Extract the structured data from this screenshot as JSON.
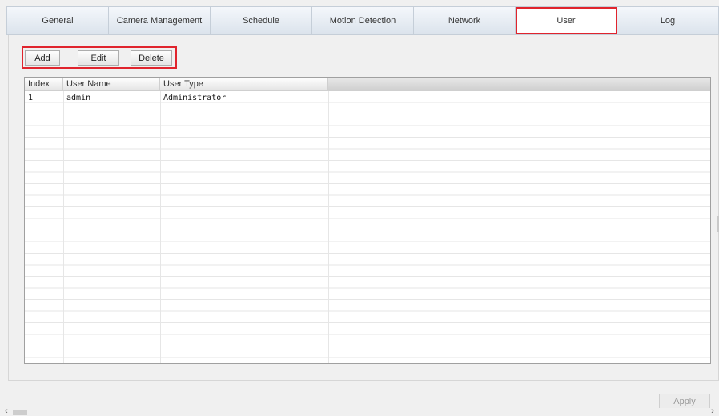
{
  "tabs": [
    {
      "label": "General",
      "active": false
    },
    {
      "label": "Camera Management",
      "active": false
    },
    {
      "label": "Schedule",
      "active": false
    },
    {
      "label": "Motion Detection",
      "active": false
    },
    {
      "label": "Network",
      "active": false
    },
    {
      "label": "User",
      "active": true
    },
    {
      "label": "Log",
      "active": false
    }
  ],
  "toolbar": {
    "add_label": "Add",
    "edit_label": "Edit",
    "delete_label": "Delete"
  },
  "table": {
    "columns": [
      "Index",
      "User Name",
      "User Type"
    ],
    "rows": [
      {
        "index": "1",
        "user_name": "admin",
        "user_type": "Administrator"
      }
    ]
  },
  "apply_label": "Apply",
  "colors": {
    "highlight": "#e0242d",
    "tab_gradient_top": "#f4f7fb",
    "tab_gradient_bottom": "#dbe3ec"
  }
}
